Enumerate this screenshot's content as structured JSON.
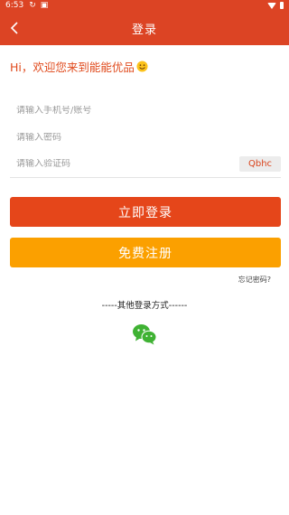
{
  "status_bar": {
    "time": "6:53"
  },
  "header": {
    "title": "登录"
  },
  "greeting": "Hi，欢迎您来到能能优品",
  "form": {
    "phone_placeholder": "请输入手机号/账号",
    "password_placeholder": "请输入密码",
    "captcha_placeholder": "请输入验证码",
    "captcha_code": "Qbhc"
  },
  "actions": {
    "login_label": "立即登录",
    "register_label": "免费注册",
    "forgot_label": "忘记密码?"
  },
  "other_login": {
    "label": "-----其他登录方式------",
    "icon": "wechat-icon"
  },
  "colors": {
    "brand": "#dc4424",
    "login_button": "#e5461a",
    "register_button": "#fba000"
  }
}
